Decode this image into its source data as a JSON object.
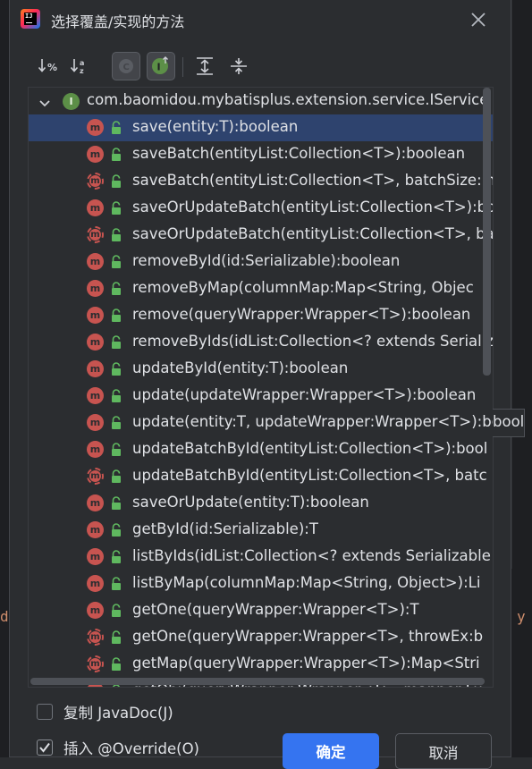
{
  "dialog": {
    "title": "选择覆盖/实现的方法",
    "toolbar": {
      "sort_visibility_icon": "sort-by-visibility-icon",
      "sort_alpha_icon": "sort-alphabetically-icon",
      "show_classes_icon": "show-classes-icon",
      "show_interfaces_icon": "show-interfaces-icon",
      "expand_all_icon": "expand-all-icon",
      "collapse_all_icon": "collapse-all-icon"
    },
    "tree": {
      "header": "com.baomidou.mybatisplus.extension.service.IService",
      "header_icon_letter": "I",
      "method_icon_letter": "m",
      "items": [
        {
          "text": "save(entity:T):boolean"
        },
        {
          "text": "saveBatch(entityList:Collection<T>):boolean"
        },
        {
          "text": "saveBatch(entityList:Collection<T>, batchSize:in"
        },
        {
          "text": "saveOrUpdateBatch(entityList:Collection<T>):bo"
        },
        {
          "text": "saveOrUpdateBatch(entityList:Collection<T>, ba"
        },
        {
          "text": "removeById(id:Serializable):boolean"
        },
        {
          "text": "removeByMap(columnMap:Map<String, Objec"
        },
        {
          "text": "remove(queryWrapper:Wrapper<T>):boolean"
        },
        {
          "text": "removeByIds(idList:Collection<? extends Serializ"
        },
        {
          "text": "updateById(entity:T):boolean"
        },
        {
          "text": "update(updateWrapper:Wrapper<T>):boolean"
        },
        {
          "text": "update(entity:T, updateWrapper:Wrapper<T>):boole"
        },
        {
          "text": "updateBatchById(entityList:Collection<T>):bool"
        },
        {
          "text": "updateBatchById(entityList:Collection<T>, batc"
        },
        {
          "text": "saveOrUpdate(entity:T):boolean"
        },
        {
          "text": "getById(id:Serializable):T"
        },
        {
          "text": "listByIds(idList:Collection<? extends Serializable"
        },
        {
          "text": "listByMap(columnMap:Map<String, Object>):Li"
        },
        {
          "text": "getOne(queryWrapper:Wrapper<T>):T"
        },
        {
          "text": "getOne(queryWrapper:Wrapper<T>, throwEx:b"
        },
        {
          "text": "getMap(queryWrapper:Wrapper<T>):Map<Stri"
        },
        {
          "text": "getObj(queryWrapper:Wrapper<T>, mapper:Fu"
        }
      ],
      "tooltip_fragment": "boole"
    },
    "options": {
      "copy_javadoc_label": "复制 JavaDoc(J)",
      "copy_javadoc_checked": false,
      "insert_override_label": "插入 @Override(O)",
      "insert_override_checked": true
    },
    "buttons": {
      "ok_label": "确定",
      "cancel_label": "取消"
    }
  },
  "background": {
    "left_char": "d",
    "right_char": "y"
  },
  "colors": {
    "selection": "#2e436e",
    "method_icon": "#c75450",
    "interface_icon": "#5c8f47",
    "primary_button": "#3574f0",
    "lock_icon": "#5fb85f"
  }
}
